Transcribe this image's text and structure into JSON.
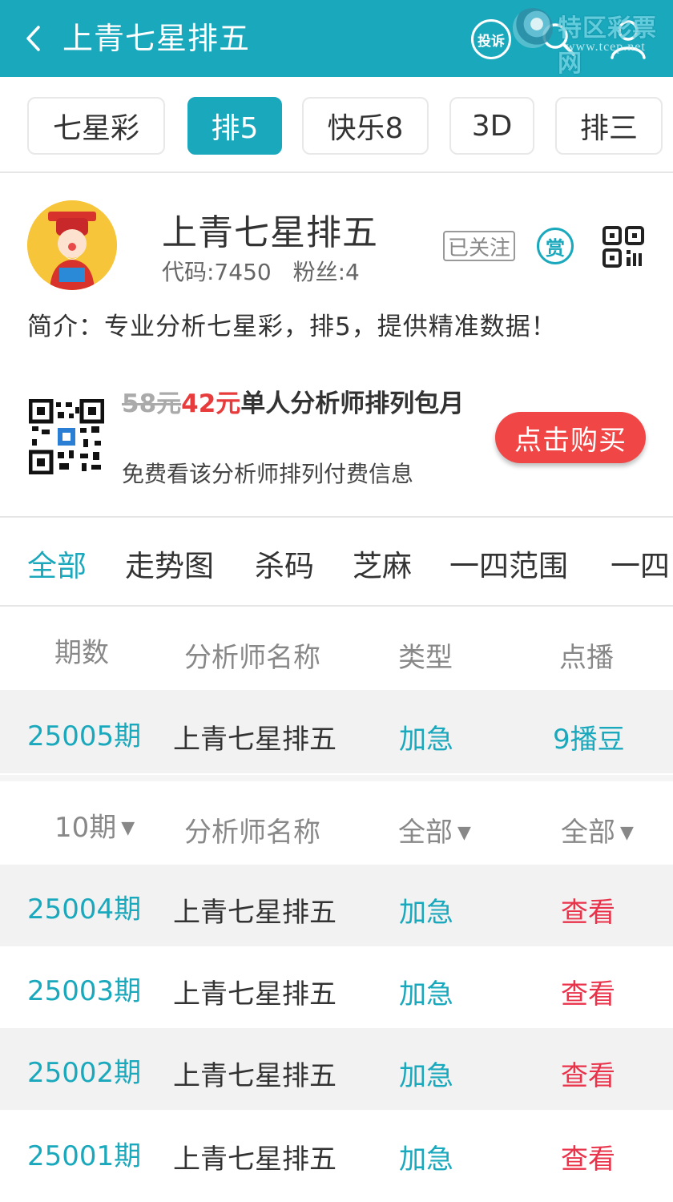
{
  "header": {
    "title": "上青七星排五",
    "complain_label": "投诉",
    "watermark_title": "特区彩票网",
    "watermark_url": "www.tcep.net"
  },
  "lottery_tabs": [
    {
      "label": "七星彩",
      "active": false
    },
    {
      "label": "排5",
      "active": true
    },
    {
      "label": "快乐8",
      "active": false
    },
    {
      "label": "3D",
      "active": false
    },
    {
      "label": "排三",
      "active": false
    }
  ],
  "profile": {
    "name": "上青七星排五",
    "code": "代码:7450",
    "fans": "粉丝:4",
    "follow_status": "已关注",
    "reward_label": "赏",
    "intro": "简介：专业分析七星彩，排5，提供精准数据！"
  },
  "promo": {
    "old_price": "58元",
    "new_price": "42元",
    "title": "单人分析师排列包月",
    "description": "免费看该分析师排列付费信息",
    "buy_label": "点击购买"
  },
  "categories": [
    "全部",
    "走势图",
    "杀码",
    "芝麻",
    "一四范围",
    "一四"
  ],
  "active_category": "全部",
  "top_table": {
    "headers": [
      "期数",
      "分析师名称",
      "类型",
      "点播"
    ],
    "rows": [
      {
        "issue": "25005期",
        "name": "上青七星排五",
        "type": "加急",
        "price": "9播豆"
      }
    ]
  },
  "history_table": {
    "filters": [
      "10期",
      "分析师名称",
      "全部",
      "全部"
    ],
    "rows": [
      {
        "issue": "25004期",
        "name": "上青七星排五",
        "type": "加急",
        "action": "查看"
      },
      {
        "issue": "25003期",
        "name": "上青七星排五",
        "type": "加急",
        "action": "查看"
      },
      {
        "issue": "25002期",
        "name": "上青七星排五",
        "type": "加急",
        "action": "查看"
      },
      {
        "issue": "25001期",
        "name": "上青七星排五",
        "type": "加急",
        "action": "查看"
      }
    ]
  },
  "colors": {
    "accent": "#1aa8bd",
    "buy_button": "#f04646",
    "action_red": "#e8334a"
  }
}
